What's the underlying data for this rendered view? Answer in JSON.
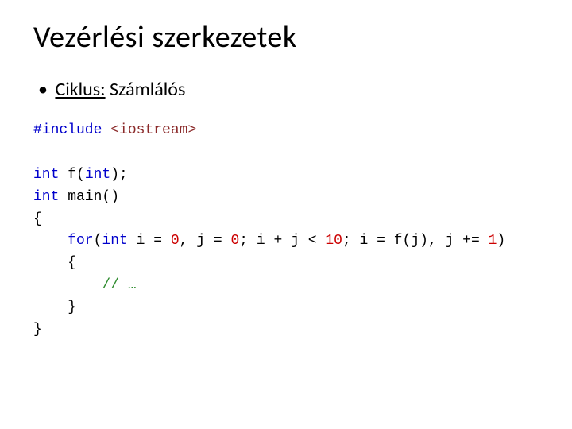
{
  "title": "Vezérlési szerkezetek",
  "bullet": {
    "label_u": "Ciklus:",
    "label": " Számlálós"
  },
  "code": {
    "l1a": "#include",
    "l1b": " <iostream>",
    "l2a": "int",
    "l2b": " f(",
    "l2c": "int",
    "l2d": ");",
    "l3a": "int",
    "l3b": " main()",
    "l4": "{",
    "l5a": "    for",
    "l5b": "(",
    "l5c": "int",
    "l5d": " i = ",
    "l5e": "0",
    "l5f": ", j = ",
    "l5g": "0",
    "l5h": "; i + j < ",
    "l5i": "10",
    "l5j": "; i = f(j), j += ",
    "l5k": "1",
    "l5l": ")",
    "l6": "    {",
    "l7a": "        ",
    "l7b": "// …",
    "l8": "    }",
    "l9": "}"
  }
}
